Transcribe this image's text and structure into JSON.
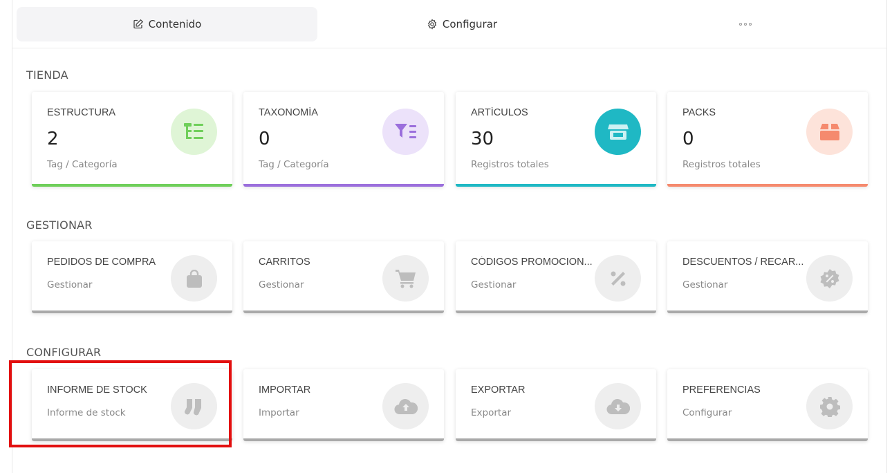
{
  "tabs": [
    {
      "label": "Contenido",
      "icon": "edit-icon",
      "active": true
    },
    {
      "label": "Configurar",
      "icon": "gear-icon",
      "active": false
    },
    {
      "label": "",
      "icon": "more-icon",
      "active": false
    }
  ],
  "sections": {
    "tienda": {
      "title": "TIENDA",
      "cards": [
        {
          "title": "ESTRUCTURA",
          "count": "2",
          "sub": "Tag / Categoría",
          "icon": "tree-structure-icon",
          "color": "#6fcf5a",
          "bg": "#dff5d6"
        },
        {
          "title": "TAXONOMÍA",
          "count": "0",
          "sub": "Tag / Categoría",
          "icon": "filter-list-icon",
          "color": "#9b6fdc",
          "bg": "#ece2fa"
        },
        {
          "title": "ARTÍCULOS",
          "count": "30",
          "sub": "Registros totales",
          "icon": "store-icon",
          "color": "#1fb8c4",
          "bg": "#cdf1f3"
        },
        {
          "title": "PACKS",
          "count": "0",
          "sub": "Registros totales",
          "icon": "box-icon",
          "color": "#f58a6e",
          "bg": "#fde3da"
        }
      ]
    },
    "gestionar": {
      "title": "GESTIONAR",
      "cards": [
        {
          "title": "PEDIDOS DE COMPRA",
          "sub": "Gestionar",
          "icon": "shopping-bag-icon"
        },
        {
          "title": "CARRITOS",
          "sub": "Gestionar",
          "icon": "cart-icon"
        },
        {
          "title": "CÓDIGOS PROMOCION...",
          "sub": "Gestionar",
          "icon": "percent-icon"
        },
        {
          "title": "DESCUENTOS / RECAR...",
          "sub": "Gestionar",
          "icon": "discount-badge-icon"
        }
      ]
    },
    "configurar": {
      "title": "CONFIGURAR",
      "cards": [
        {
          "title": "INFORME DE STOCK",
          "sub": "Informe de stock",
          "icon": "socks-icon"
        },
        {
          "title": "IMPORTAR",
          "sub": "Importar",
          "icon": "cloud-upload-icon"
        },
        {
          "title": "EXPORTAR",
          "sub": "Exportar",
          "icon": "cloud-download-icon"
        },
        {
          "title": "PREFERENCIAS",
          "sub": "Configurar",
          "icon": "gear-icon"
        }
      ]
    }
  },
  "colors": {
    "neutral_bar": "#a9a9a9",
    "neutral_circle": "#eeeeee",
    "neutral_icon": "#bdbdbd",
    "highlight": "#e20f0f"
  }
}
